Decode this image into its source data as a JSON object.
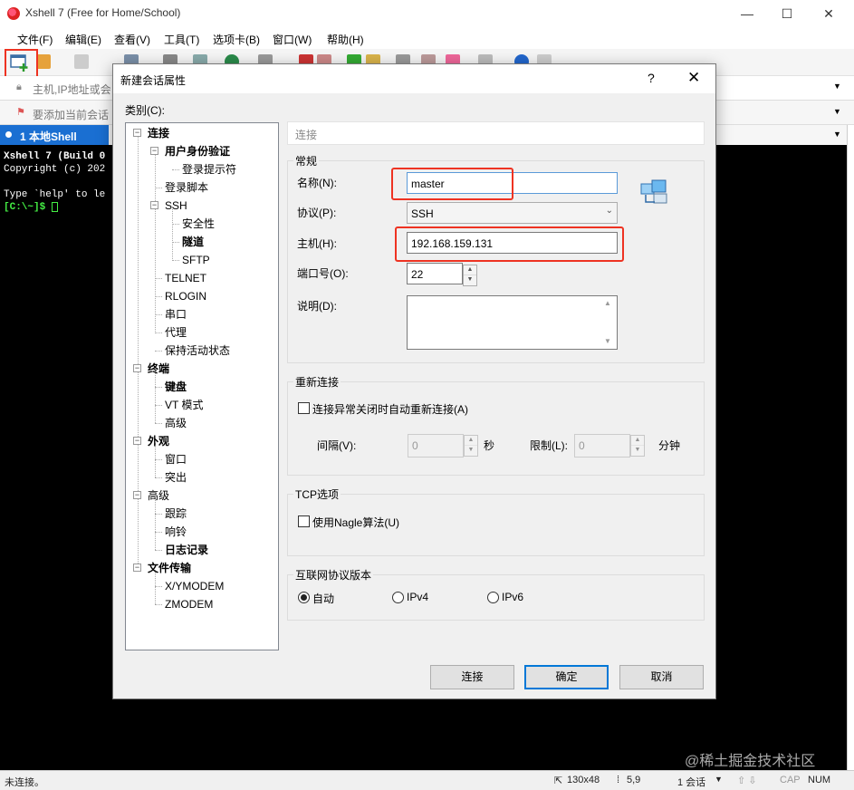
{
  "window": {
    "title": "Xshell 7 (Free for Home/School)",
    "minimize": "—",
    "maximize": "☐",
    "close": "✕"
  },
  "menu": [
    "文件(F)",
    "编辑(E)",
    "查看(V)",
    "工具(T)",
    "选项卡(B)",
    "窗口(W)",
    "帮助(H)"
  ],
  "address_placeholder": "主机,IP地址或会",
  "bookmark_text": "要添加当前会话",
  "tab": {
    "label": "1 本地Shell"
  },
  "terminal": {
    "line1": "Xshell 7 (Build 0",
    "line2": "Copyright (c) 202",
    "line3": "Type `help' to le",
    "prompt": "[C:\\~]$ "
  },
  "watermark": "@稀土掘金技术社区",
  "status": {
    "left": "未连接。",
    "size": "130x48",
    "pos": "5,9",
    "sessions": "1 会话",
    "cap": "CAP",
    "num": "NUM"
  },
  "dialog": {
    "title": "新建会话属性",
    "help": "?",
    "close": "✕",
    "category_label": "类别(C):",
    "section_header": "连接",
    "tree": [
      {
        "label": "连接",
        "bold": true,
        "level": 0,
        "expand": "−"
      },
      {
        "label": "用户身份验证",
        "bold": true,
        "level": 1,
        "expand": "−"
      },
      {
        "label": "登录提示符",
        "bold": false,
        "level": 2
      },
      {
        "label": "登录脚本",
        "bold": false,
        "level": 1
      },
      {
        "label": "SSH",
        "bold": false,
        "level": 1,
        "expand": "−"
      },
      {
        "label": "安全性",
        "bold": false,
        "level": 2
      },
      {
        "label": "隧道",
        "bold": true,
        "level": 2
      },
      {
        "label": "SFTP",
        "bold": false,
        "level": 2
      },
      {
        "label": "TELNET",
        "bold": false,
        "level": 1
      },
      {
        "label": "RLOGIN",
        "bold": false,
        "level": 1
      },
      {
        "label": "串口",
        "bold": false,
        "level": 1
      },
      {
        "label": "代理",
        "bold": false,
        "level": 1
      },
      {
        "label": "保持活动状态",
        "bold": false,
        "level": 1
      },
      {
        "label": "终端",
        "bold": true,
        "level": 0,
        "expand": "−"
      },
      {
        "label": "键盘",
        "bold": true,
        "level": 1
      },
      {
        "label": "VT 模式",
        "bold": false,
        "level": 1
      },
      {
        "label": "高级",
        "bold": false,
        "level": 1
      },
      {
        "label": "外观",
        "bold": true,
        "level": 0,
        "expand": "−"
      },
      {
        "label": "窗口",
        "bold": false,
        "level": 1
      },
      {
        "label": "突出",
        "bold": false,
        "level": 1
      },
      {
        "label": "高级",
        "bold": false,
        "level": 0,
        "expand": "−"
      },
      {
        "label": "跟踪",
        "bold": false,
        "level": 1
      },
      {
        "label": "响铃",
        "bold": false,
        "level": 1
      },
      {
        "label": "日志记录",
        "bold": true,
        "level": 1
      },
      {
        "label": "文件传输",
        "bold": true,
        "level": 0,
        "expand": "−"
      },
      {
        "label": "X/YMODEM",
        "bold": false,
        "level": 1
      },
      {
        "label": "ZMODEM",
        "bold": false,
        "level": 1
      }
    ],
    "general": {
      "title": "常规",
      "name_label": "名称(N):",
      "name_value": "master",
      "protocol_label": "协议(P):",
      "protocol_value": "SSH",
      "host_label": "主机(H):",
      "host_value": "192.168.159.131",
      "port_label": "端口号(O):",
      "port_value": "22",
      "desc_label": "说明(D):",
      "desc_value": ""
    },
    "reconnect": {
      "title": "重新连接",
      "checkbox_label": "连接异常关闭时自动重新连接(A)",
      "interval_label": "间隔(V):",
      "interval_value": "0",
      "interval_unit": "秒",
      "limit_label": "限制(L):",
      "limit_value": "0",
      "limit_unit": "分钟"
    },
    "tcp": {
      "title": "TCP选项",
      "nagle_label": "使用Nagle算法(U)"
    },
    "ip": {
      "title": "互联网协议版本",
      "auto": "自动",
      "ipv4": "IPv4",
      "ipv6": "IPv6",
      "selected": "自动"
    },
    "buttons": {
      "connect": "连接",
      "ok": "确定",
      "cancel": "取消"
    }
  }
}
